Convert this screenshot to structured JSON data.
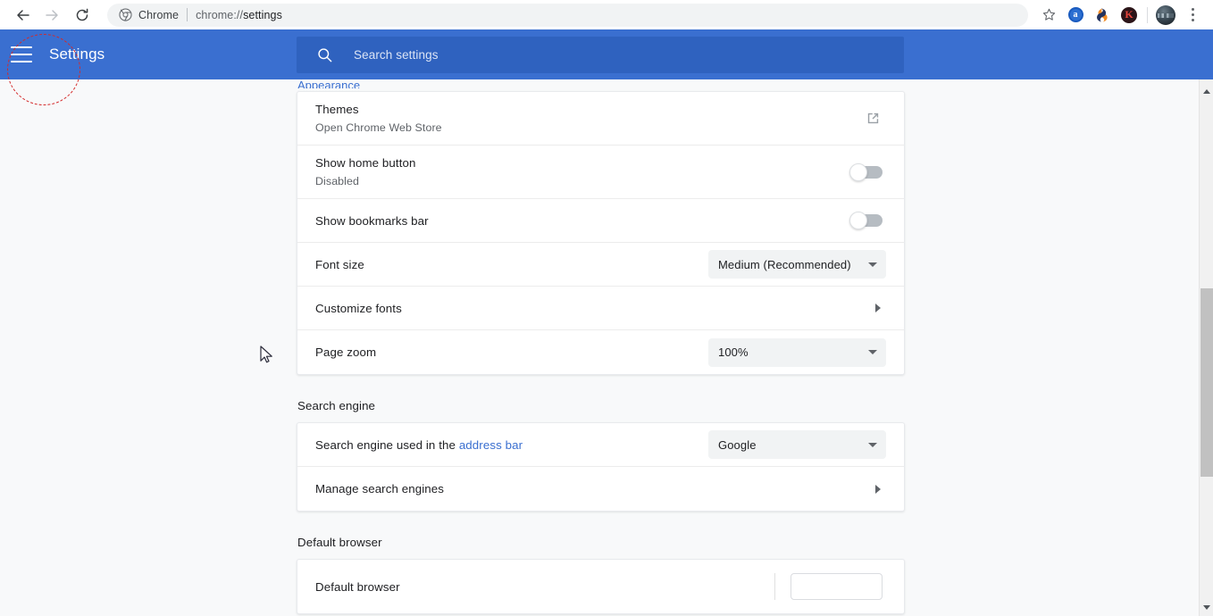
{
  "browser": {
    "nav": {
      "back_label": "Back",
      "forward_label": "Forward",
      "reload_label": "Reload"
    },
    "omnibox": {
      "chip_label": "Chrome",
      "url_prefix": "chrome://",
      "url_bold": "settings",
      "favicon_name": "chrome-logo-icon"
    },
    "toolbar_right": {
      "bookmark_label": "Bookmark this tab",
      "extension_1_label": "a",
      "extension_2_label": "",
      "extension_3_label": "K",
      "profile_label": "Profile",
      "menu_label": "Customize and control Google Chrome"
    }
  },
  "settings_header": {
    "menu_label": "Main menu",
    "title": "Settings",
    "search": {
      "placeholder": "Search settings",
      "value": "",
      "icon": "search-icon"
    },
    "background_color": "#3a6fd0",
    "search_background_color": "#2f62bf"
  },
  "annotation": {
    "shape": "dashed-circle",
    "color": "#d42a2a",
    "target": "main-menu-hamburger"
  },
  "appearance": {
    "section_title": "Appearance",
    "rows": [
      {
        "title": "Themes",
        "sub": "Open Chrome Web Store",
        "control": "external-link",
        "control_name": "open-chrome-web-store-icon"
      },
      {
        "title": "Show home button",
        "sub": "Disabled",
        "control": "toggle",
        "control_name": "show-home-button-toggle",
        "toggle_on": false
      },
      {
        "title": "Show bookmarks bar",
        "sub": "",
        "control": "toggle",
        "control_name": "show-bookmarks-bar-toggle",
        "toggle_on": false
      },
      {
        "title": "Font size",
        "sub": "",
        "control": "select",
        "control_name": "font-size-select",
        "value": "Medium (Recommended)"
      },
      {
        "title": "Customize fonts",
        "sub": "",
        "control": "chevron",
        "control_name": "customize-fonts-chevron-right-icon"
      },
      {
        "title": "Page zoom",
        "sub": "",
        "control": "select",
        "control_name": "page-zoom-select",
        "value": "100%"
      }
    ]
  },
  "search_engine": {
    "section_title": "Search engine",
    "row_label_prefix": "Search engine used in the ",
    "row_label_link": "address bar",
    "selected_engine": "Google",
    "manage_label": "Manage search engines"
  },
  "default_browser": {
    "section_title": "Default browser",
    "row_title": "Default browser"
  },
  "scrollbar": {
    "up_arrow": "scroll-up-arrow-icon",
    "down_arrow": "scroll-down-arrow-icon"
  }
}
